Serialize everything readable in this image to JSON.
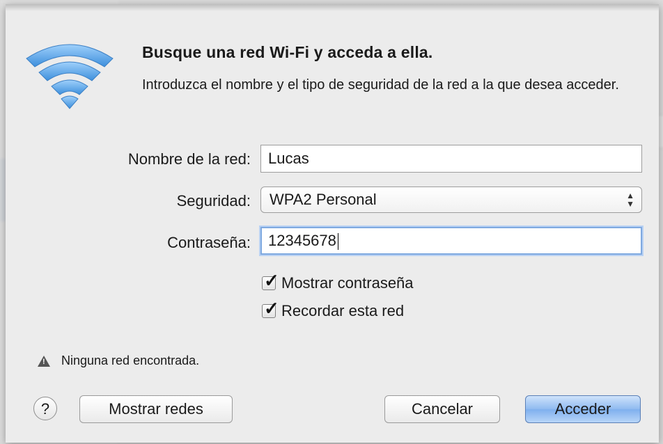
{
  "dialog": {
    "title": "Busque una red Wi-Fi y acceda a ella.",
    "description": "Introduzca el nombre y el tipo de seguridad de la red a la que desea acceder."
  },
  "form": {
    "network_name_label": "Nombre de la red:",
    "network_name_value": "Lucas",
    "security_label": "Seguridad:",
    "security_value": "WPA2 Personal",
    "password_label": "Contraseña:",
    "password_value": "12345678",
    "show_password_label": "Mostrar contraseña",
    "show_password_checked": true,
    "remember_network_label": "Recordar esta red",
    "remember_network_checked": true
  },
  "status": {
    "warning_text": "Ninguna red encontrada."
  },
  "buttons": {
    "help_label": "?",
    "show_networks_label": "Mostrar redes",
    "cancel_label": "Cancelar",
    "join_label": "Acceder"
  },
  "icons": {
    "wifi": "wifi-icon",
    "warning": "warning-icon",
    "checkbox_mark": "checkmark-icon"
  },
  "colors": {
    "accent": "#7fb0ee",
    "wifi_blue": "#5fa8e8"
  }
}
